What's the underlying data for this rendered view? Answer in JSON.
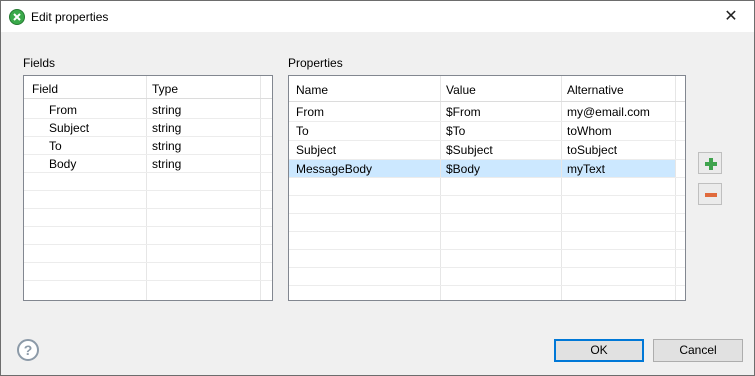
{
  "window": {
    "title": "Edit properties",
    "close_glyph": "✕"
  },
  "fields": {
    "label": "Fields",
    "headers": [
      "Field",
      "Type"
    ],
    "rows": [
      [
        "From",
        "string"
      ],
      [
        "Subject",
        "string"
      ],
      [
        "To",
        "string"
      ],
      [
        "Body",
        "string"
      ]
    ]
  },
  "properties": {
    "label": "Properties",
    "headers": [
      "Name",
      "Value",
      "Alternative"
    ],
    "rows": [
      [
        "From",
        "$From",
        "my@email.com"
      ],
      [
        "To",
        "$To",
        "toWhom"
      ],
      [
        "Subject",
        "$Subject",
        "toSubject"
      ],
      [
        "MessageBody",
        "$Body",
        "myText"
      ]
    ],
    "selected_row": 3
  },
  "side_buttons": {
    "add_icon": "plus-icon",
    "remove_icon": "minus-icon"
  },
  "footer": {
    "help_glyph": "?",
    "ok_label": "OK",
    "cancel_label": "Cancel"
  },
  "colors": {
    "selection": "#cce8ff",
    "add": "#3fa34d",
    "remove": "#e06a3c",
    "default_border": "#0078d7"
  }
}
